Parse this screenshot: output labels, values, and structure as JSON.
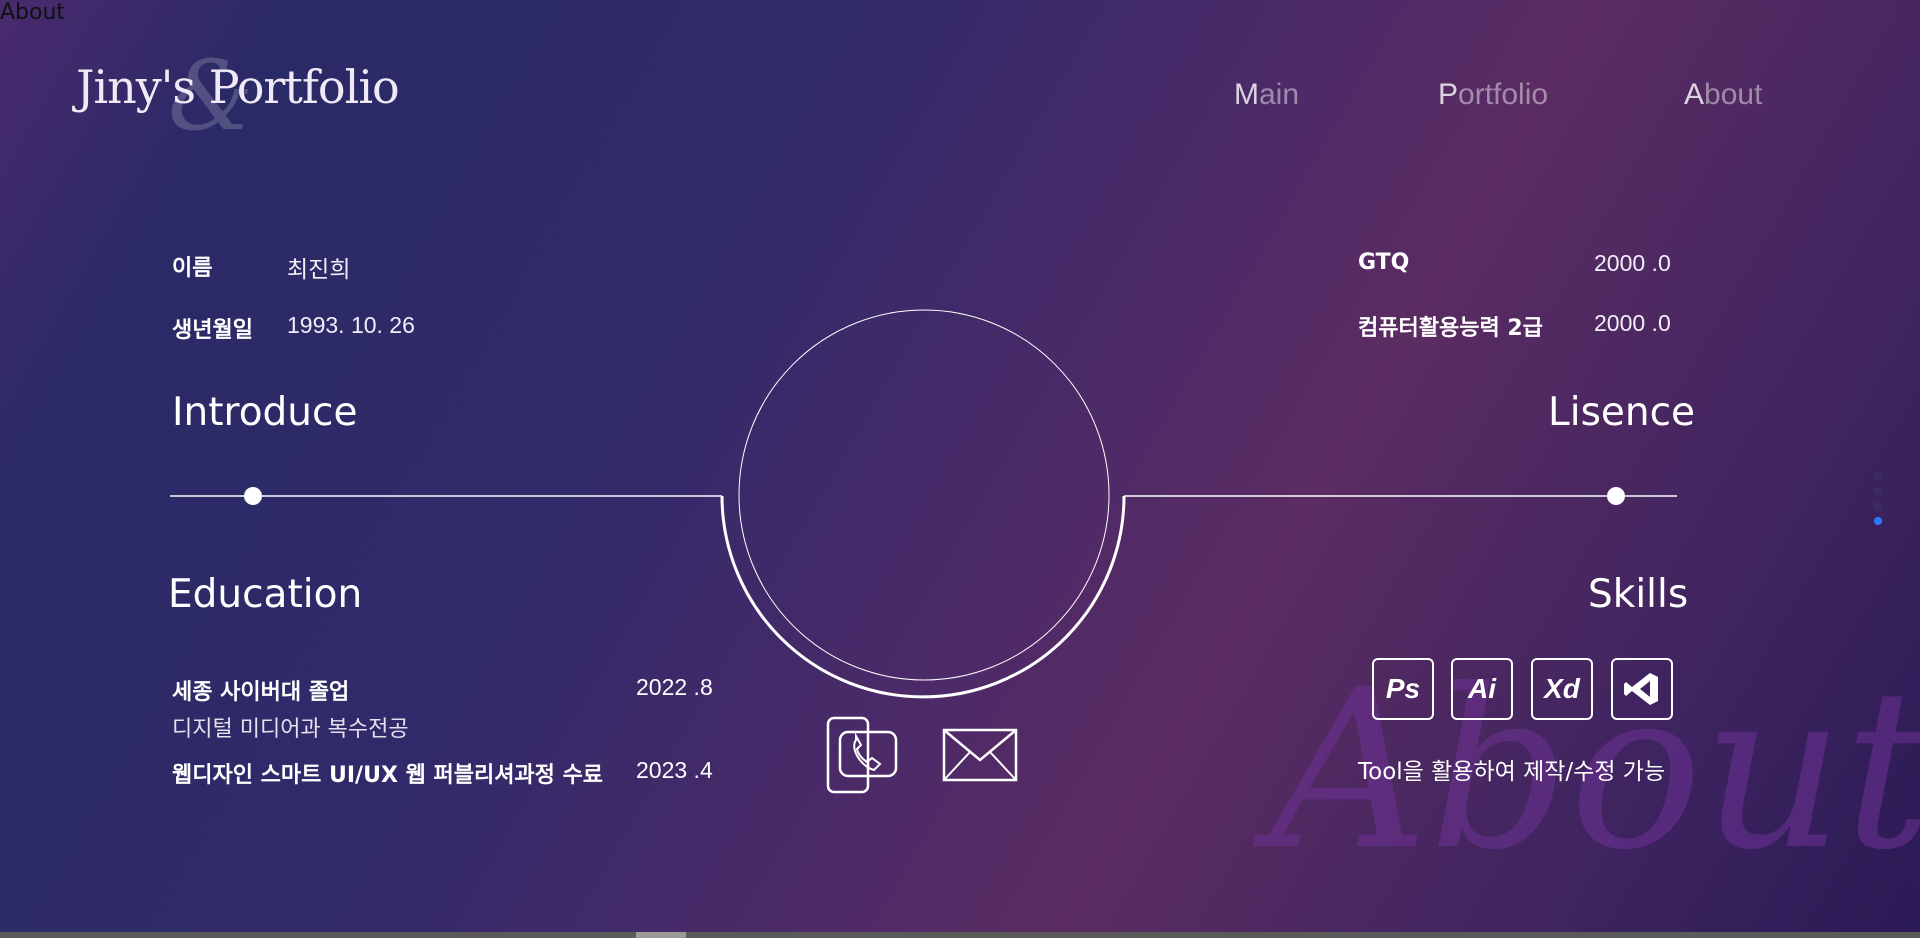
{
  "corner_label": "About",
  "logo": {
    "text": "Jiny's Portfolio",
    "amp": "&"
  },
  "nav": [
    {
      "first": "M",
      "rest": "ain"
    },
    {
      "first": "P",
      "rest": "ortfolio"
    },
    {
      "first": "A",
      "rest": "bout"
    }
  ],
  "profile": {
    "name_label": "이름",
    "name_value": "최진희",
    "birth_label": "생년월일",
    "birth_value": "1993. 10. 26"
  },
  "licenses": [
    {
      "label": "GTQ",
      "date": "2000 .0"
    },
    {
      "label": "컴퓨터활용능력 2급",
      "date": "2000 .0"
    }
  ],
  "sections": {
    "introduce": "Introduce",
    "lisence": "Lisence",
    "education": "Education",
    "skills": "Skills"
  },
  "education": [
    {
      "title": "세종 사이버대 졸업",
      "sub": "디지털 미디어과 복수전공",
      "date": "2022 .8"
    },
    {
      "title": "웹디자인 스마트 UI/UX 웹 퍼블리셔과정 수료",
      "date": "2023 .4"
    }
  ],
  "skills": {
    "icons": [
      "Ps",
      "Ai",
      "Xd"
    ],
    "text": "Tool을 활용하여 제작/수정 가능"
  },
  "about_bg": "About",
  "colors": {
    "accent_dot": "#2a7bff"
  }
}
